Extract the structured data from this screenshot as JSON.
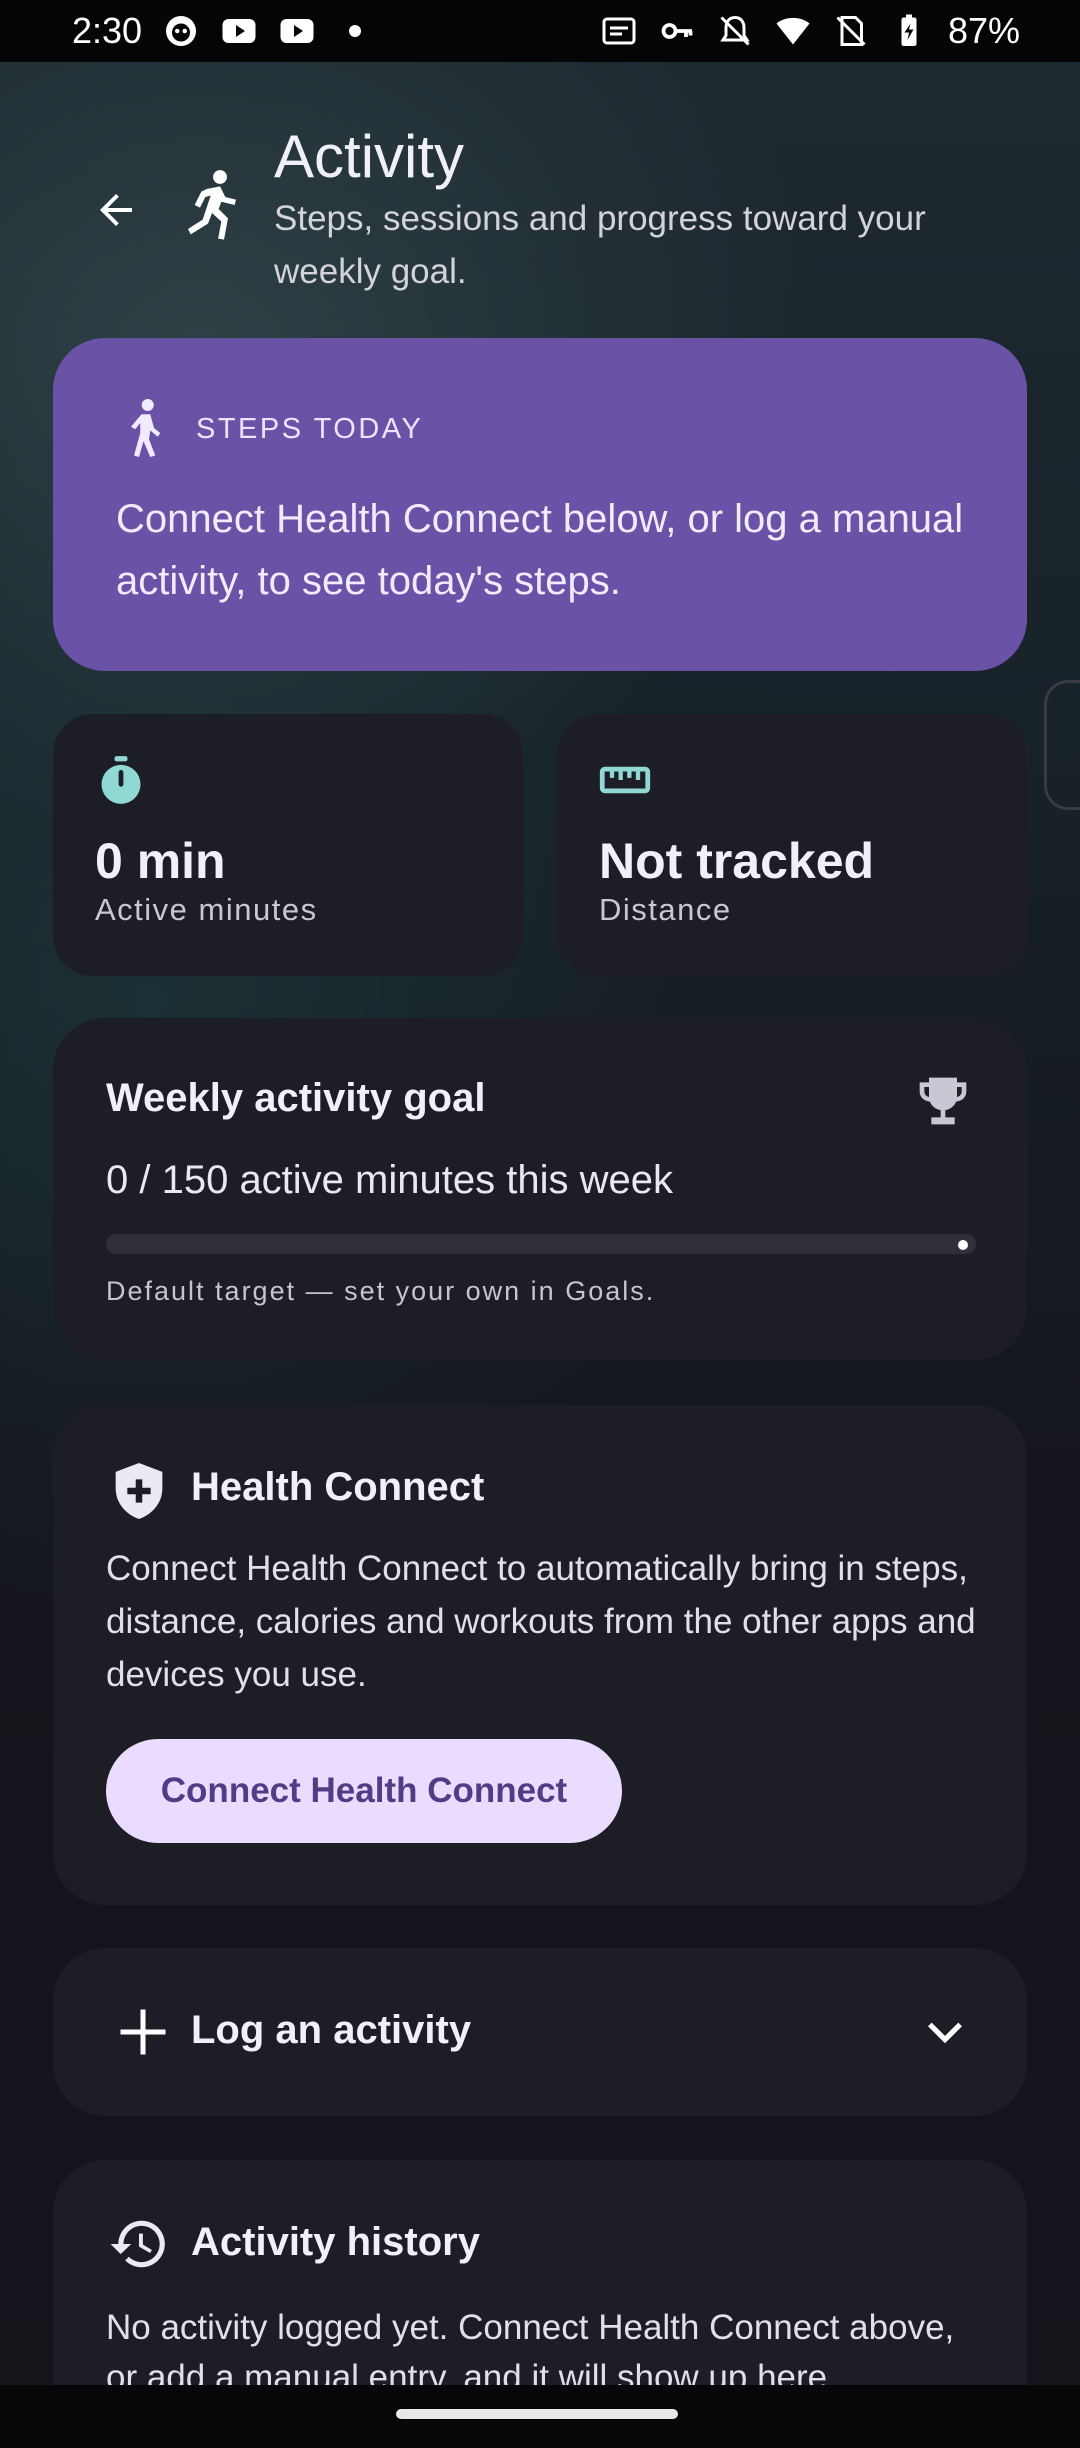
{
  "status_bar": {
    "time": "2:30",
    "battery": "87%",
    "icons_left": [
      "custom-app-icon",
      "youtube-icon",
      "youtube-icon",
      "dot-icon"
    ],
    "icons_right": [
      "auto-hd-icon",
      "vpn-key-icon",
      "notifications-off-icon",
      "wifi-icon",
      "no-sim-icon",
      "battery-charging-icon"
    ]
  },
  "header": {
    "title": "Activity",
    "subtitle": "Steps, sessions and progress toward your weekly goal.",
    "back_icon": "arrow-back-icon",
    "title_icon": "running-icon"
  },
  "steps_card": {
    "heading": "STEPS TODAY",
    "text": "Connect Health Connect below, or log a manual activity, to see today's steps.",
    "icon": "walking-icon",
    "color": "#6a52a6"
  },
  "stats": {
    "active": {
      "value": "0 min",
      "label": "Active minutes",
      "icon": "timer-icon"
    },
    "distance": {
      "value": "Not tracked",
      "label": "Distance",
      "icon": "ruler-icon"
    }
  },
  "goal": {
    "title": "Weekly activity goal",
    "progress_text": "0 / 150 active minutes this week",
    "note": "Default target — set your own in Goals.",
    "progress_fraction": 0,
    "icon": "trophy-icon"
  },
  "health_connect": {
    "title": "Health Connect",
    "text": "Connect Health Connect to automatically bring in steps, distance, calories and workouts from the other apps and devices you use.",
    "button_label": "Connect Health Connect",
    "icon": "shield-plus-icon"
  },
  "log": {
    "title": "Log an activity",
    "icon": "plus-icon",
    "chevron": "chevron-down-icon"
  },
  "history": {
    "title": "Activity history",
    "text": "No activity logged yet. Connect Health Connect above, or add a manual entry, and it will show up here.",
    "icon": "history-icon"
  },
  "colors": {
    "accent": "#6a52a6",
    "icon_teal": "#8fd8d4",
    "button_bg": "#eadcff",
    "button_text": "#4f3d85",
    "card_bg": "#1d1d26"
  }
}
